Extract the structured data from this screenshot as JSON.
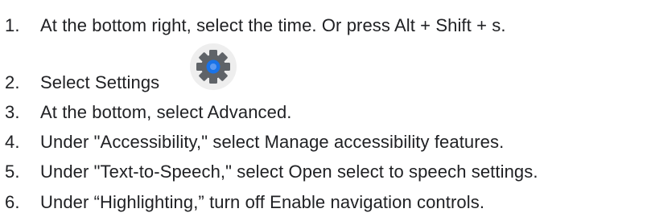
{
  "steps": [
    {
      "number": "1.",
      "text": "At the bottom right, select the time. Or press Alt + Shift + s."
    },
    {
      "number": "2.",
      "text": "Select Settings",
      "trailing": ".",
      "icon": "settings-gear-icon"
    },
    {
      "number": "3.",
      "text": "At the bottom, select Advanced."
    },
    {
      "number": "4.",
      "text": "Under \"Accessibility,\" select Manage accessibility features."
    },
    {
      "number": "5.",
      "text": "Under \"Text-to-Speech,\" select Open select to speech settings."
    },
    {
      "number": "6.",
      "text": "Under “Highlighting,” turn off Enable navigation controls."
    }
  ],
  "colors": {
    "text": "#202124",
    "icon_background": "#eeeeee",
    "gear": "#5f6368",
    "gear_center": "#1a73e8"
  }
}
